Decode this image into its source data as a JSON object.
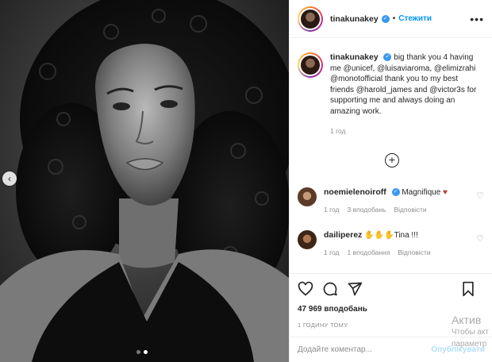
{
  "post": {
    "username": "tinakunakey",
    "follow_label": "Стежити",
    "separator": "•",
    "more_label": "•••",
    "caption": "big thank you 4 having me @unicef, @luisaviaroma, @elimizrahi @monotofficial thank you to my best friends @harold_james and @victor3s for supporting me and always doing an amazing work.",
    "caption_time": "1 год",
    "likes": "47 969 вподобань",
    "posted": "1 ГОДИНУ ТОМУ"
  },
  "comments": [
    {
      "username": "noemielenoiroff",
      "verified": true,
      "text": "Magnifique",
      "emoji": "♥",
      "time": "1 год",
      "likes": "3 вподобань",
      "reply": "Відповісти"
    },
    {
      "username": "dailiperez",
      "verified": false,
      "text": "✋✋✋Tina !!!",
      "time": "1 год",
      "likes": "1 вподобання",
      "reply": "Відповісти"
    }
  ],
  "add_comment": {
    "placeholder": "Додайте коментар...",
    "publish": "Опублікувати"
  },
  "watermark": {
    "line1": "Актив",
    "line2": "Чтобы акт",
    "line3": "параметр"
  },
  "icons": [
    "heart-icon",
    "comment-icon",
    "share-icon",
    "bookmark-icon",
    "more-icon",
    "load-more-icon",
    "chevron-left-icon"
  ],
  "colors": {
    "link": "#0095f6",
    "verified": "#3897f0",
    "muted": "#8e8e8e",
    "heart": "#c0392b"
  }
}
